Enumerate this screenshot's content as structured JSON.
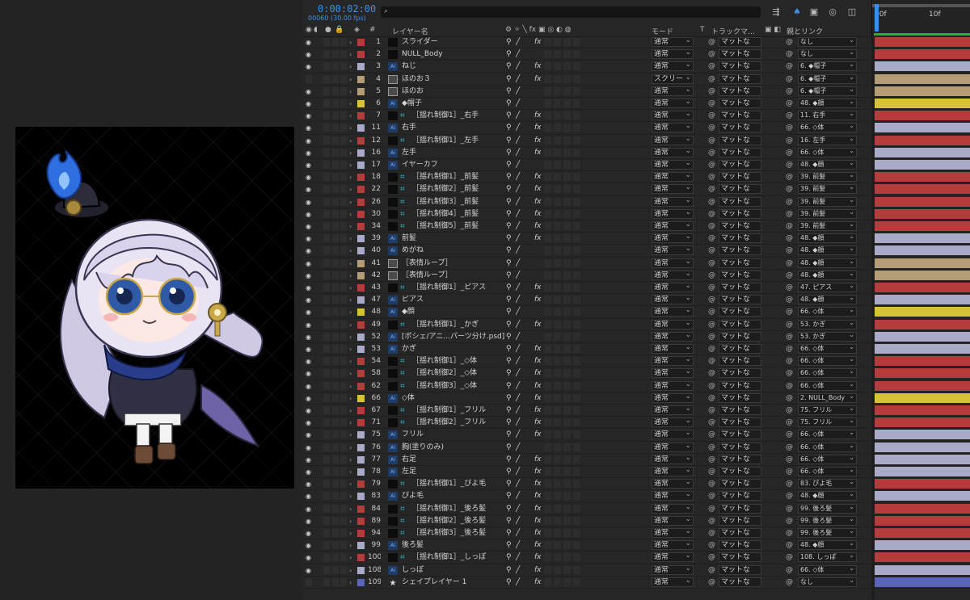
{
  "timecode": "0:00:02:00",
  "fps": "00060 (30.00 fps)",
  "columns": {
    "layer_name": "レイヤー名",
    "mode": "モード",
    "t": "T",
    "track_matte": "トラックマ…",
    "parent": "親とリンク"
  },
  "ruler": {
    "start": "00f",
    "mark": "10f"
  },
  "icons": {
    "search": "search-icon",
    "eye": "eye-icon",
    "audio": "speaker-icon",
    "solo": "solo-dot-icon",
    "lock": "lock-icon",
    "tag": "tag-icon",
    "expand": "chevron-right-icon",
    "null": "hash-icon",
    "pickwhip": "spiral-icon"
  },
  "colors": {
    "accent": "#3d8fe6",
    "red": "#b53c3c",
    "lavender": "#a9a9c8",
    "tan": "#b49c74",
    "yellow": "#d6c236",
    "blue": "#5966b8"
  },
  "layers": [
    {
      "eye": true,
      "color": "red",
      "num": "1",
      "thumb": "black",
      "indent": false,
      "name": "スライダー",
      "fx": true,
      "mode": "通常",
      "matte": "マットな",
      "parent": "なし",
      "bar": "red"
    },
    {
      "eye": true,
      "color": "red",
      "num": "2",
      "thumb": "black",
      "indent": false,
      "name": "NULL_Body",
      "fx": false,
      "mode": "通常",
      "matte": "マットな",
      "parent": "なし",
      "bar": "red"
    },
    {
      "eye": true,
      "color": "lavender",
      "num": "3",
      "thumb": "ai",
      "indent": false,
      "name": "ねじ",
      "fx": true,
      "mode": "通常",
      "matte": "マットな",
      "parent": "6. ◆帽子",
      "bar": "lavender"
    },
    {
      "eye": false,
      "color": "tan",
      "num": "4",
      "thumb": "img",
      "indent": false,
      "name": "ほのお３",
      "fx": true,
      "mode": "スクリー",
      "matte": "マットな",
      "parent": "6. ◆帽子",
      "bar": "tan"
    },
    {
      "eye": true,
      "color": "tan",
      "num": "5",
      "thumb": "img",
      "indent": false,
      "name": "ほのお",
      "fx": false,
      "mode": "通常",
      "matte": "マットな",
      "parent": "6. ◆帽子",
      "bar": "tan"
    },
    {
      "eye": true,
      "color": "yellow",
      "num": "6",
      "thumb": "ai",
      "indent": false,
      "name": "◆帽子",
      "fx": false,
      "mode": "通常",
      "matte": "マットな",
      "parent": "48. ◆顔",
      "bar": "yellow"
    },
    {
      "eye": true,
      "color": "red",
      "num": "7",
      "thumb": "null",
      "indent": true,
      "name": "［揺れ制御1］_右手",
      "fx": true,
      "mode": "通常",
      "matte": "マットな",
      "parent": "11. 右手",
      "bar": "red"
    },
    {
      "eye": true,
      "color": "lavender",
      "num": "11",
      "thumb": "ai",
      "indent": false,
      "name": "右手",
      "fx": true,
      "mode": "通常",
      "matte": "マットな",
      "parent": "66. ◇体",
      "bar": "lavender"
    },
    {
      "eye": true,
      "color": "red",
      "num": "12",
      "thumb": "null",
      "indent": true,
      "name": "［揺れ制御1］_左手",
      "fx": true,
      "mode": "通常",
      "matte": "マットな",
      "parent": "16. 左手",
      "bar": "red"
    },
    {
      "eye": true,
      "color": "lavender",
      "num": "16",
      "thumb": "ai",
      "indent": false,
      "name": "左手",
      "fx": true,
      "mode": "通常",
      "matte": "マットな",
      "parent": "66. ◇体",
      "bar": "lavender"
    },
    {
      "eye": true,
      "color": "lavender",
      "num": "17",
      "thumb": "ai",
      "indent": false,
      "name": "イヤーカフ",
      "fx": false,
      "mode": "通常",
      "matte": "マットな",
      "parent": "48. ◆顔",
      "bar": "lavender"
    },
    {
      "eye": true,
      "color": "red",
      "num": "18",
      "thumb": "null",
      "indent": true,
      "name": "［揺れ制御1］_前髪",
      "fx": true,
      "mode": "通常",
      "matte": "マットな",
      "parent": "39. 前髪",
      "bar": "red"
    },
    {
      "eye": true,
      "color": "red",
      "num": "22",
      "thumb": "null",
      "indent": true,
      "name": "［揺れ制御2］_前髪",
      "fx": true,
      "mode": "通常",
      "matte": "マットな",
      "parent": "39. 前髪",
      "bar": "red"
    },
    {
      "eye": true,
      "color": "red",
      "num": "26",
      "thumb": "null",
      "indent": true,
      "name": "［揺れ制御3］_前髪",
      "fx": true,
      "mode": "通常",
      "matte": "マットな",
      "parent": "39. 前髪",
      "bar": "red"
    },
    {
      "eye": true,
      "color": "red",
      "num": "30",
      "thumb": "null",
      "indent": true,
      "name": "［揺れ制御4］_前髪",
      "fx": true,
      "mode": "通常",
      "matte": "マットな",
      "parent": "39. 前髪",
      "bar": "red"
    },
    {
      "eye": true,
      "color": "red",
      "num": "34",
      "thumb": "null",
      "indent": true,
      "name": "［揺れ制御5］_前髪",
      "fx": true,
      "mode": "通常",
      "matte": "マットな",
      "parent": "39. 前髪",
      "bar": "red"
    },
    {
      "eye": true,
      "color": "lavender",
      "num": "39",
      "thumb": "ai",
      "indent": false,
      "name": "前髪",
      "fx": true,
      "mode": "通常",
      "matte": "マットな",
      "parent": "48. ◆顔",
      "bar": "lavender"
    },
    {
      "eye": true,
      "color": "lavender",
      "num": "40",
      "thumb": "ai",
      "indent": false,
      "name": "めがね",
      "fx": false,
      "mode": "通常",
      "matte": "マットな",
      "parent": "48. ◆顔",
      "bar": "lavender"
    },
    {
      "eye": true,
      "color": "tan",
      "num": "41",
      "thumb": "img",
      "indent": false,
      "name": "［表情ループ］",
      "fx": false,
      "mode": "通常",
      "matte": "マットな",
      "parent": "48. ◆顔",
      "bar": "tan"
    },
    {
      "eye": true,
      "color": "tan",
      "num": "42",
      "thumb": "img",
      "indent": false,
      "name": "［表情ループ］",
      "fx": false,
      "mode": "通常",
      "matte": "マットな",
      "parent": "48. ◆顔",
      "bar": "tan"
    },
    {
      "eye": true,
      "color": "red",
      "num": "43",
      "thumb": "null",
      "indent": true,
      "name": "［揺れ制御1］_ピアス",
      "fx": true,
      "mode": "通常",
      "matte": "マットな",
      "parent": "47. ピアス",
      "bar": "red"
    },
    {
      "eye": true,
      "color": "lavender",
      "num": "47",
      "thumb": "ai",
      "indent": false,
      "name": "ピアス",
      "fx": true,
      "mode": "通常",
      "matte": "マットな",
      "parent": "48. ◆顔",
      "bar": "lavender"
    },
    {
      "eye": true,
      "color": "yellow",
      "num": "48",
      "thumb": "ai",
      "indent": false,
      "name": "◆顔",
      "fx": false,
      "mode": "通常",
      "matte": "マットな",
      "parent": "66. ◇体",
      "bar": "yellow"
    },
    {
      "eye": true,
      "color": "red",
      "num": "49",
      "thumb": "null",
      "indent": true,
      "name": "［揺れ制御1］_かぎ",
      "fx": true,
      "mode": "通常",
      "matte": "マットな",
      "parent": "53. かぎ",
      "bar": "red"
    },
    {
      "eye": true,
      "color": "lavender",
      "num": "52",
      "thumb": "ai",
      "indent": false,
      "name": "[ポシェ/アニ...パーツ分け.psd]",
      "fx": false,
      "mode": "通常",
      "matte": "マットな",
      "parent": "53. かぎ",
      "bar": "lavender"
    },
    {
      "eye": true,
      "color": "lavender",
      "num": "53",
      "thumb": "ai",
      "indent": false,
      "name": "かぎ",
      "fx": true,
      "mode": "通常",
      "matte": "マットな",
      "parent": "66. ◇体",
      "bar": "lavender"
    },
    {
      "eye": true,
      "color": "red",
      "num": "54",
      "thumb": "null",
      "indent": true,
      "name": "［揺れ制御1］_◇体",
      "fx": true,
      "mode": "通常",
      "matte": "マットな",
      "parent": "66. ◇体",
      "bar": "red"
    },
    {
      "eye": true,
      "color": "red",
      "num": "58",
      "thumb": "null",
      "indent": true,
      "name": "［揺れ制御2］_◇体",
      "fx": true,
      "mode": "通常",
      "matte": "マットな",
      "parent": "66. ◇体",
      "bar": "red"
    },
    {
      "eye": true,
      "color": "red",
      "num": "62",
      "thumb": "null",
      "indent": true,
      "name": "［揺れ制御3］_◇体",
      "fx": true,
      "mode": "通常",
      "matte": "マットな",
      "parent": "66. ◇体",
      "bar": "red"
    },
    {
      "eye": true,
      "color": "yellow",
      "num": "66",
      "thumb": "ai",
      "indent": false,
      "name": "◇体",
      "fx": true,
      "mode": "通常",
      "matte": "マットな",
      "parent": "2. NULL_Body",
      "bar": "yellow"
    },
    {
      "eye": true,
      "color": "red",
      "num": "67",
      "thumb": "null",
      "indent": true,
      "name": "［揺れ制御1］_フリル",
      "fx": true,
      "mode": "通常",
      "matte": "マットな",
      "parent": "75. フリル",
      "bar": "red"
    },
    {
      "eye": true,
      "color": "red",
      "num": "71",
      "thumb": "null",
      "indent": true,
      "name": "［揺れ制御2］_フリル",
      "fx": true,
      "mode": "通常",
      "matte": "マットな",
      "parent": "75. フリル",
      "bar": "red"
    },
    {
      "eye": true,
      "color": "lavender",
      "num": "75",
      "thumb": "ai",
      "indent": false,
      "name": "フリル",
      "fx": true,
      "mode": "通常",
      "matte": "マットな",
      "parent": "66. ◇体",
      "bar": "lavender"
    },
    {
      "eye": true,
      "color": "lavender",
      "num": "76",
      "thumb": "ai",
      "indent": false,
      "name": "胸(塗りのみ)",
      "fx": false,
      "mode": "通常",
      "matte": "マットな",
      "parent": "66. ◇体",
      "bar": "lavender"
    },
    {
      "eye": true,
      "color": "lavender",
      "num": "77",
      "thumb": "ai",
      "indent": false,
      "name": "右足",
      "fx": true,
      "mode": "通常",
      "matte": "マットな",
      "parent": "66. ◇体",
      "bar": "lavender"
    },
    {
      "eye": true,
      "color": "lavender",
      "num": "78",
      "thumb": "ai",
      "indent": false,
      "name": "左足",
      "fx": true,
      "mode": "通常",
      "matte": "マットな",
      "parent": "66. ◇体",
      "bar": "lavender"
    },
    {
      "eye": true,
      "color": "red",
      "num": "79",
      "thumb": "null",
      "indent": true,
      "name": "［揺れ制御1］_ぴよ毛",
      "fx": true,
      "mode": "通常",
      "matte": "マットな",
      "parent": "83. ぴよ毛",
      "bar": "red"
    },
    {
      "eye": true,
      "color": "lavender",
      "num": "83",
      "thumb": "ai",
      "indent": false,
      "name": "ぴよ毛",
      "fx": true,
      "mode": "通常",
      "matte": "マットな",
      "parent": "48. ◆顔",
      "bar": "lavender"
    },
    {
      "eye": true,
      "color": "red",
      "num": "84",
      "thumb": "null",
      "indent": true,
      "name": "［揺れ制御1］_後ろ髪",
      "fx": true,
      "mode": "通常",
      "matte": "マットな",
      "parent": "99. 後ろ髪",
      "bar": "red"
    },
    {
      "eye": true,
      "color": "red",
      "num": "89",
      "thumb": "null",
      "indent": true,
      "name": "［揺れ制御2］_後ろ髪",
      "fx": true,
      "mode": "通常",
      "matte": "マットな",
      "parent": "99. 後ろ髪",
      "bar": "red"
    },
    {
      "eye": true,
      "color": "red",
      "num": "94",
      "thumb": "null",
      "indent": true,
      "name": "［揺れ制御3］_後ろ髪",
      "fx": true,
      "mode": "通常",
      "matte": "マットな",
      "parent": "99. 後ろ髪",
      "bar": "red"
    },
    {
      "eye": true,
      "color": "lavender",
      "num": "99",
      "thumb": "ai",
      "indent": false,
      "name": "後ろ髪",
      "fx": true,
      "mode": "通常",
      "matte": "マットな",
      "parent": "48. ◆顔",
      "bar": "lavender"
    },
    {
      "eye": true,
      "color": "red",
      "num": "100",
      "thumb": "null",
      "indent": true,
      "name": "［揺れ制御1］_しっぽ",
      "fx": true,
      "mode": "通常",
      "matte": "マットな",
      "parent": "108. しっぽ",
      "bar": "red"
    },
    {
      "eye": true,
      "color": "lavender",
      "num": "108",
      "thumb": "ai",
      "indent": false,
      "name": "しっぽ",
      "fx": true,
      "mode": "通常",
      "matte": "マットな",
      "parent": "66. ◇体",
      "bar": "lavender"
    },
    {
      "eye": false,
      "color": "blue",
      "num": "109",
      "thumb": "star",
      "indent": false,
      "name": "シェイプレイヤー 1",
      "fx": true,
      "mode": "通常",
      "matte": "マットな",
      "parent": "なし",
      "bar": "blue"
    }
  ]
}
